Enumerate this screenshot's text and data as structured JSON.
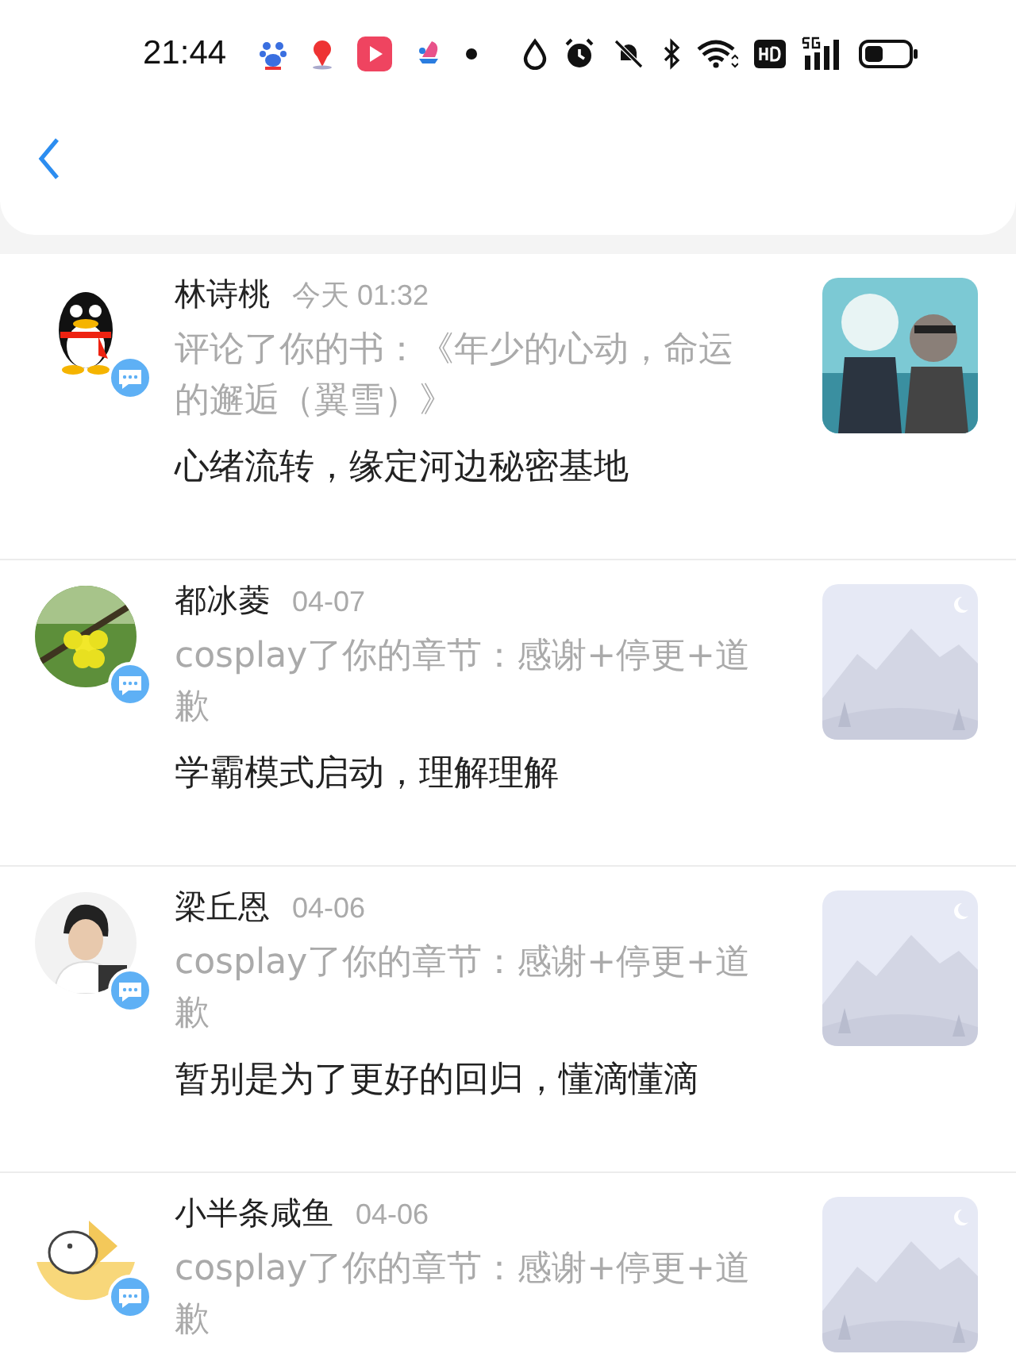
{
  "status_bar": {
    "time": "21:44"
  },
  "notifications": [
    {
      "name": "林诗桃",
      "time": "今天 01:32",
      "action": "评论了你的书：《年少的心动，命运的邂逅（翼雪）》",
      "content": "心绪流转，缘定河边秘密基地",
      "avatar": {
        "kind": "penguin"
      },
      "thumbnail": {
        "kind": "cover"
      }
    },
    {
      "name": "都冰菱",
      "time": "04-07",
      "action": "cosplay了你的章节：感谢+停更+道歉",
      "content": "学霸模式启动，理解理解",
      "avatar": {
        "kind": "flower"
      },
      "thumbnail": {
        "kind": "placeholder"
      }
    },
    {
      "name": "梁丘恩",
      "time": "04-06",
      "action": "cosplay了你的章节：感谢+停更+道歉",
      "content": "暂别是为了更好的回归，懂滴懂滴",
      "avatar": {
        "kind": "person"
      },
      "thumbnail": {
        "kind": "placeholder"
      }
    },
    {
      "name": "小半条咸鱼",
      "time": "04-06",
      "action": "cosplay了你的章节：感谢+停更+道歉",
      "avatar": {
        "kind": "sketch"
      },
      "thumbnail": {
        "kind": "placeholder"
      }
    }
  ]
}
